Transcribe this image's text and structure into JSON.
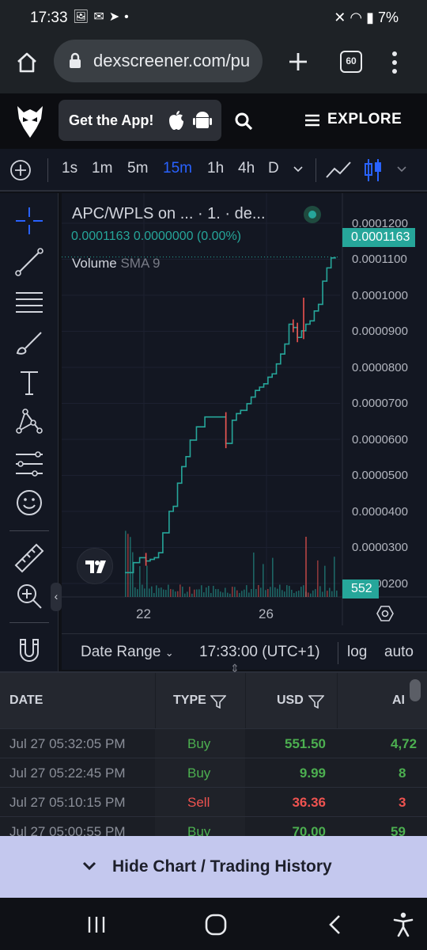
{
  "status_bar": {
    "time": "17:33",
    "battery": "7%"
  },
  "browser": {
    "url": "dexscreener.com/pu",
    "tab_count": "60"
  },
  "site_header": {
    "get_app_label": "Get the App!",
    "explore_label": "EXPLORE"
  },
  "timeframes": [
    "1s",
    "1m",
    "5m",
    "15m",
    "1h",
    "4h",
    "D"
  ],
  "active_timeframe": "15m",
  "chart": {
    "symbol_title": "APC/WPLS on ... · 1. · de...",
    "price_line": "0.0001163  0.0000000 (0.00%)",
    "volume_label": "Volume",
    "volume_indicator": "SMA 9",
    "current_price_tag": "0.0001163",
    "volume_tag": "552",
    "y_ticks": [
      "0.0001200",
      "0.0001100",
      "0.0001000",
      "0.0000900",
      "0.0000800",
      "0.0000700",
      "0.0000600",
      "0.0000500",
      "0.0000400",
      "0.0000300",
      "0.0000200"
    ],
    "x_ticks": [
      "22",
      "26"
    ],
    "up_color": "#26a69a",
    "down_color": "#ef5350"
  },
  "chart_data": {
    "type": "line",
    "ylim": [
      1.7e-05,
      0.000126
    ],
    "x": [
      0,
      4,
      7,
      10,
      12,
      14,
      16,
      18,
      21,
      23,
      25,
      27,
      29,
      31,
      34,
      38,
      41,
      45,
      48,
      51,
      53,
      55,
      58,
      60,
      62,
      64,
      66,
      68,
      70,
      72,
      74,
      76,
      78,
      80,
      82,
      84,
      86,
      88,
      90,
      92,
      94,
      96,
      98,
      100
    ],
    "y": [
      2.1e-05,
      2.4e-05,
      2.55e-05,
      2.45e-05,
      2.5e-05,
      2.55e-05,
      2.7e-05,
      3.3e-05,
      3.95e-05,
      4.1e-05,
      4.8e-05,
      5.3e-05,
      5.6e-05,
      6.1e-05,
      6.5e-05,
      6.8e-05,
      6.8e-05,
      6.8e-05,
      6e-05,
      6.7e-05,
      6.9e-05,
      7e-05,
      7.2e-05,
      7.4e-05,
      7.6e-05,
      7.7e-05,
      7.8e-05,
      8e-05,
      8.1e-05,
      8.4e-05,
      8.7e-05,
      9e-05,
      9.6e-05,
      9.5e-05,
      9.2e-05,
      9.4e-05,
      9.6e-05,
      9.7e-05,
      0.0001,
      0.000102,
      0.000109,
      0.000113,
      0.000116,
      0.0001163
    ]
  },
  "chart_bottom": {
    "date_range": "Date Range",
    "time": "17:33:00 (UTC+1)",
    "log": "log",
    "auto": "auto"
  },
  "trades": {
    "headers": [
      "DATE",
      "TYPE",
      "USD",
      "AI"
    ],
    "rows": [
      {
        "date": "Jul 27 05:32:05 PM",
        "type": "Buy",
        "usd": "551.50",
        "amount": "4,72"
      },
      {
        "date": "Jul 27 05:22:45 PM",
        "type": "Buy",
        "usd": "9.99",
        "amount": "8"
      },
      {
        "date": "Jul 27 05:10:15 PM",
        "type": "Sell",
        "usd": "36.36",
        "amount": "3"
      },
      {
        "date": "Jul 27 05:00:55 PM",
        "type": "Buy",
        "usd": "70.00",
        "amount": "59"
      }
    ]
  },
  "hide_bar": {
    "label": "Hide Chart / Trading History"
  }
}
